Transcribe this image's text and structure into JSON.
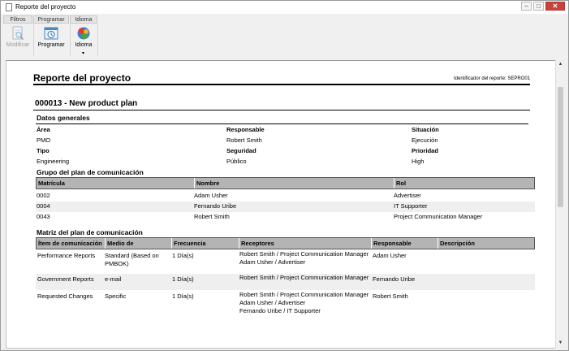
{
  "window": {
    "title": "Reporte del proyecto"
  },
  "ribbon": {
    "tabs": [
      "Filtros",
      "Programar",
      "Idioma"
    ],
    "buttons": [
      {
        "label": "Modificar",
        "icon": "document-search-icon",
        "enabled": false
      },
      {
        "label": "Programar",
        "icon": "calendar-clock-icon",
        "enabled": true
      },
      {
        "label": "Idioma",
        "icon": "globe-language-icon",
        "enabled": true
      }
    ]
  },
  "report": {
    "title": "Reporte del proyecto",
    "id_label": "Identificador del reporte: SEPRO01",
    "plan_title": "000013 - New product plan",
    "general": {
      "heading": "Datos generales",
      "fields": [
        {
          "label": "Área",
          "value": "PMO"
        },
        {
          "label": "Responsable",
          "value": "Robert Smith"
        },
        {
          "label": "Situación",
          "value": "Ejecución"
        },
        {
          "label": "Tipo",
          "value": "Engineering"
        },
        {
          "label": "Seguridad",
          "value": "Público"
        },
        {
          "label": "Prioridad",
          "value": "High"
        }
      ]
    },
    "group": {
      "heading": "Grupo del plan de comunicación",
      "columns": [
        "Matrícula",
        "Nombre",
        "Rol"
      ],
      "rows": [
        [
          "0002",
          "Adam Usher",
          "Advertiser"
        ],
        [
          "0004",
          "Fernando Uribe",
          "IT Supporter"
        ],
        [
          "0043",
          "Robert Smith",
          "Project Communication Manager"
        ]
      ]
    },
    "matrix": {
      "heading": "Matriz del plan de comunicación",
      "columns": [
        "Ítem de comunicación",
        "Medio de",
        "Frecuencia",
        "Receptores",
        "Responsable",
        "Descripción"
      ],
      "rows": [
        [
          "Performance Reports",
          "Standard (Based on PMBOK)",
          "1 Día(s)",
          "Robert Smith / Project Communication Manager\nAdam Usher / Advertiser",
          "Adam Usher",
          ""
        ],
        [
          "Government Reports",
          "e-mail",
          "1 Día(s)",
          "Robert Smith / Project Communication Manager",
          "Fernando Uribe",
          ""
        ],
        [
          "Requested Changes",
          "Specific",
          "1 Día(s)",
          "Robert Smith / Project Communication Manager\nAdam Usher / Advertiser\nFernando Uribe / IT Supporter",
          "Robert Smith",
          ""
        ]
      ]
    }
  }
}
